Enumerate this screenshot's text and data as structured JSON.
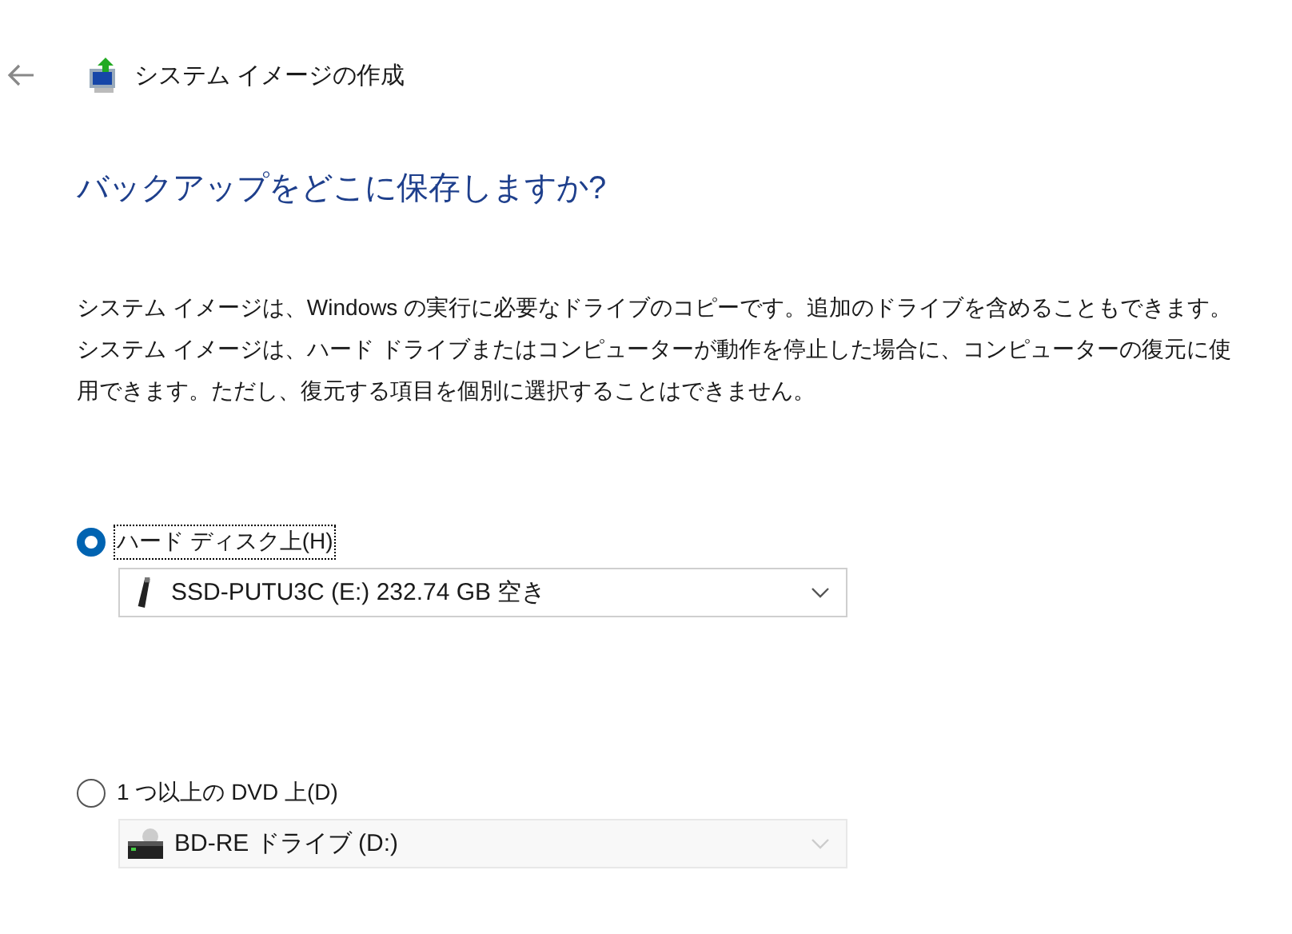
{
  "window": {
    "title": "システム イメージの作成"
  },
  "heading": "バックアップをどこに保存しますか?",
  "description": "システム イメージは、Windows の実行に必要なドライブのコピーです。追加のドライブを含めることもできます。システム イメージは、ハード ドライブまたはコンピューターが動作を停止した場合に、コンピューターの復元に使用できます。ただし、復元する項目を個別に選択することはできません。",
  "destinations": [
    {
      "label": "ハード ディスク上(H)",
      "selected": true,
      "focused": true,
      "drive": {
        "kind": "usb",
        "value": "SSD-PUTU3C (E:)  232.74 GB 空き",
        "disabled": false
      }
    },
    {
      "label": "1 つ以上の DVD 上(D)",
      "selected": false,
      "focused": false,
      "drive": {
        "kind": "disc",
        "value": "BD-RE ドライブ (D:)",
        "disabled": true
      }
    }
  ]
}
